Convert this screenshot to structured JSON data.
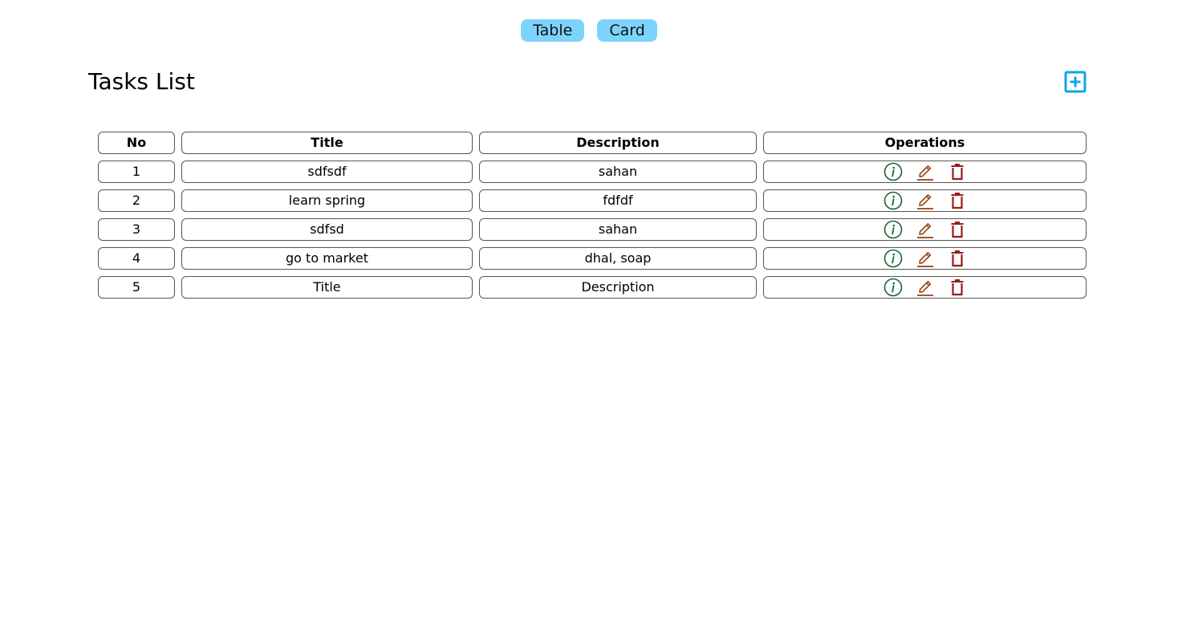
{
  "view_toggle": {
    "table_label": "Table",
    "card_label": "Card"
  },
  "page_title": "Tasks List",
  "icons": {
    "add": "plus-square-icon",
    "info": "info-circle-icon",
    "edit": "pencil-icon",
    "delete": "trash-icon"
  },
  "colors": {
    "toggle_bg": "#7dd3fc",
    "add_icon": "#0ea5e9",
    "info_icon": "#166534",
    "edit_icon": "#92400e",
    "delete_icon": "#991b1b"
  },
  "table": {
    "headers": {
      "no": "No",
      "title": "Title",
      "description": "Description",
      "operations": "Operations"
    },
    "rows": [
      {
        "no": "1",
        "title": "sdfsdf",
        "description": "sahan"
      },
      {
        "no": "2",
        "title": "learn spring",
        "description": "fdfdf"
      },
      {
        "no": "3",
        "title": "sdfsd",
        "description": "sahan"
      },
      {
        "no": "4",
        "title": "go to market",
        "description": "dhal, soap"
      },
      {
        "no": "5",
        "title": "Title",
        "description": "Description"
      }
    ]
  }
}
